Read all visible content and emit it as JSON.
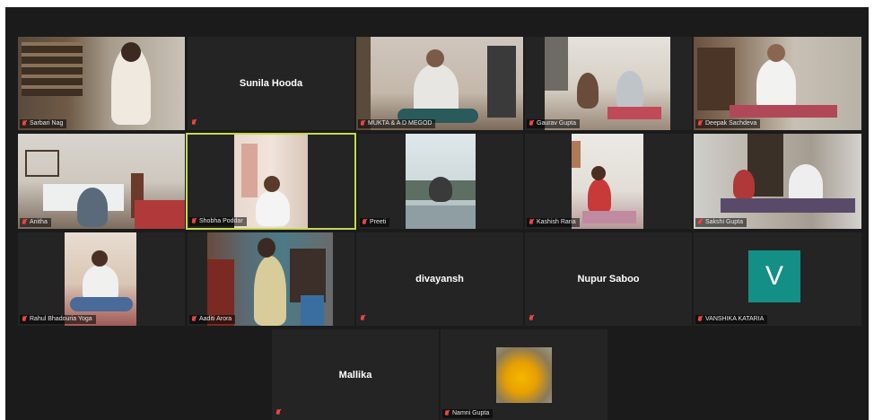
{
  "participants": [
    {
      "name": "Sarbari Nag"
    },
    {
      "name": "Sunila Hooda"
    },
    {
      "name": "MUKTA & A D MEGOD"
    },
    {
      "name": "Gaurav Gupta"
    },
    {
      "name": "Deepak Sachdeva"
    },
    {
      "name": "Anitha"
    },
    {
      "name": "Shobha Poddar"
    },
    {
      "name": "Preeti"
    },
    {
      "name": "Kashish Rana"
    },
    {
      "name": "Sakshi Gupta"
    },
    {
      "name": "Rahul Bhadouria Yoga"
    },
    {
      "name": "Aaditi Arora"
    },
    {
      "name": "divayansh"
    },
    {
      "name": "Nupur Saboo"
    },
    {
      "name": "VANSHIKA KATARIA",
      "initial": "V"
    },
    {
      "name": "Mallika"
    },
    {
      "name": "Namni Gupta"
    }
  ],
  "colors": {
    "background": "#1b1b1b",
    "tile": "#242424",
    "active_speaker": "#c6d94a",
    "avatar": "#138f86"
  }
}
